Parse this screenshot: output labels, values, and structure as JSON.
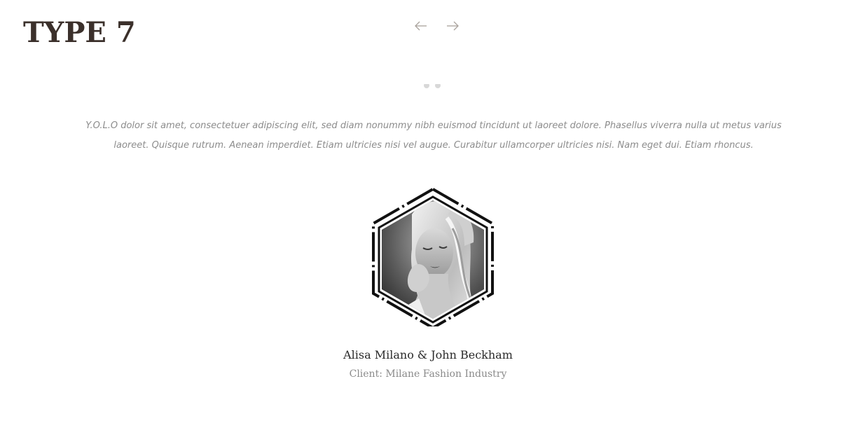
{
  "section": {
    "title": "TYPE 7"
  },
  "carousel": {
    "prev_icon": "arrow-left-icon",
    "next_icon": "arrow-right-icon",
    "arrow_color": "#a9a29c"
  },
  "testimonial": {
    "quote_icon": "quote-icon",
    "text": "Y.O.L.O dolor sit amet, consectetuer adipiscing elit, sed diam nonummy nibh euismod tincidunt ut laoreet dolore. Phasellus viverra nulla ut metus varius laoreet. Quisque rutrum. Aenean imperdiet. Etiam ultricies nisi vel augue. Curabitur ullamcorper ultricies nisi. Nam eget dui. Etiam rhoncus.",
    "avatar_alt": "client-portrait",
    "client_name": "Alisa Milano & John Beckham",
    "client_role": "Client: Milane Fashion Industry"
  },
  "colors": {
    "title": "#3b302b",
    "text_muted": "#8c8c8c",
    "frame": "#111111"
  }
}
